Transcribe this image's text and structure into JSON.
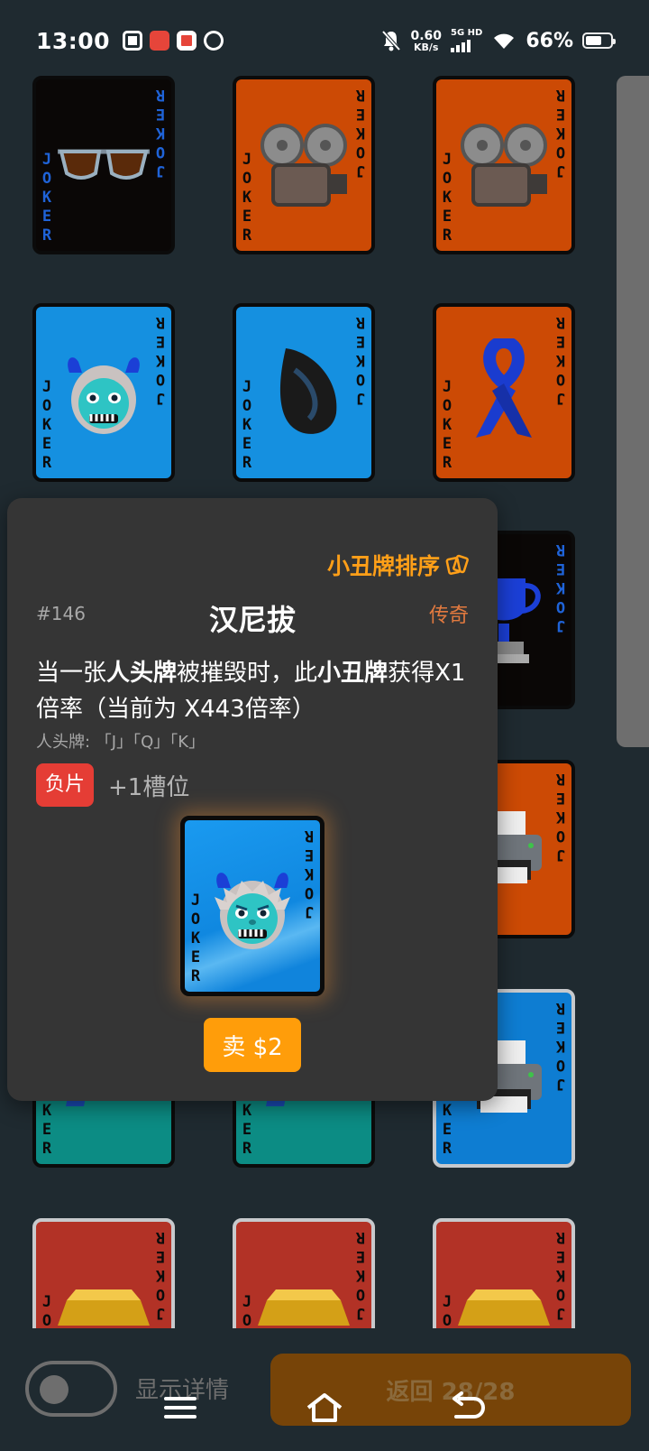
{
  "status_bar": {
    "time": "13:00",
    "net_speed_value": "0.60",
    "net_speed_unit": "KB/s",
    "signal_label": "5G HD",
    "battery_percent": "66%",
    "battery_level": 0.66,
    "notification_icons": [
      "scissors-app-icon",
      "toutiao-app-icon",
      "avatar-app-icon",
      "loop-app-icon"
    ]
  },
  "card_back_text": "JOKER",
  "grid": {
    "cards": [
      {
        "bg": "black",
        "art": "sunglasses"
      },
      {
        "bg": "orange",
        "art": "film-projector"
      },
      {
        "bg": "orange",
        "art": "film-projector"
      },
      {
        "bg": "blue",
        "art": "ogre"
      },
      {
        "bg": "blue",
        "art": "spiral-shell"
      },
      {
        "bg": "orange",
        "art": "ribbon"
      },
      {
        "bg": "black",
        "art": "trophy"
      },
      {
        "bg": "orange",
        "art": "printer"
      },
      {
        "bg": "teal",
        "art": "water-pistol"
      },
      {
        "bg": "teal",
        "art": "water-pistol"
      },
      {
        "bg": "blue2",
        "art": "printer",
        "edition": "silver"
      },
      {
        "bg": "red",
        "art": "gold-bar",
        "edition": "silver"
      },
      {
        "bg": "red",
        "art": "gold-bar",
        "edition": "silver"
      },
      {
        "bg": "red",
        "art": "gold-bar",
        "edition": "silver"
      }
    ]
  },
  "popup": {
    "sort_label": "小丑牌排序",
    "card_id": "#146",
    "title": "汉尼拔",
    "rarity": "传奇",
    "desc_part1": "当一张",
    "desc_bold1": "人头牌",
    "desc_part2": "被摧毁时，此",
    "desc_bold2": "小丑牌",
    "desc_part3": "获得X1倍率（当前为 X443倍率）",
    "note": "人头牌: 「J」「Q」「K」",
    "edition_badge": "负片",
    "slot_text": "+1槽位",
    "sell_label": "卖 $2"
  },
  "bottom": {
    "toggle_label": "显示详情",
    "toggle_on": false,
    "return_label": "返回 28/28"
  },
  "colors": {
    "background": "#1f2a30",
    "accent_orange": "#ff9d0a",
    "rarity_color": "#e37a3f",
    "negative_badge": "#e53d35"
  }
}
